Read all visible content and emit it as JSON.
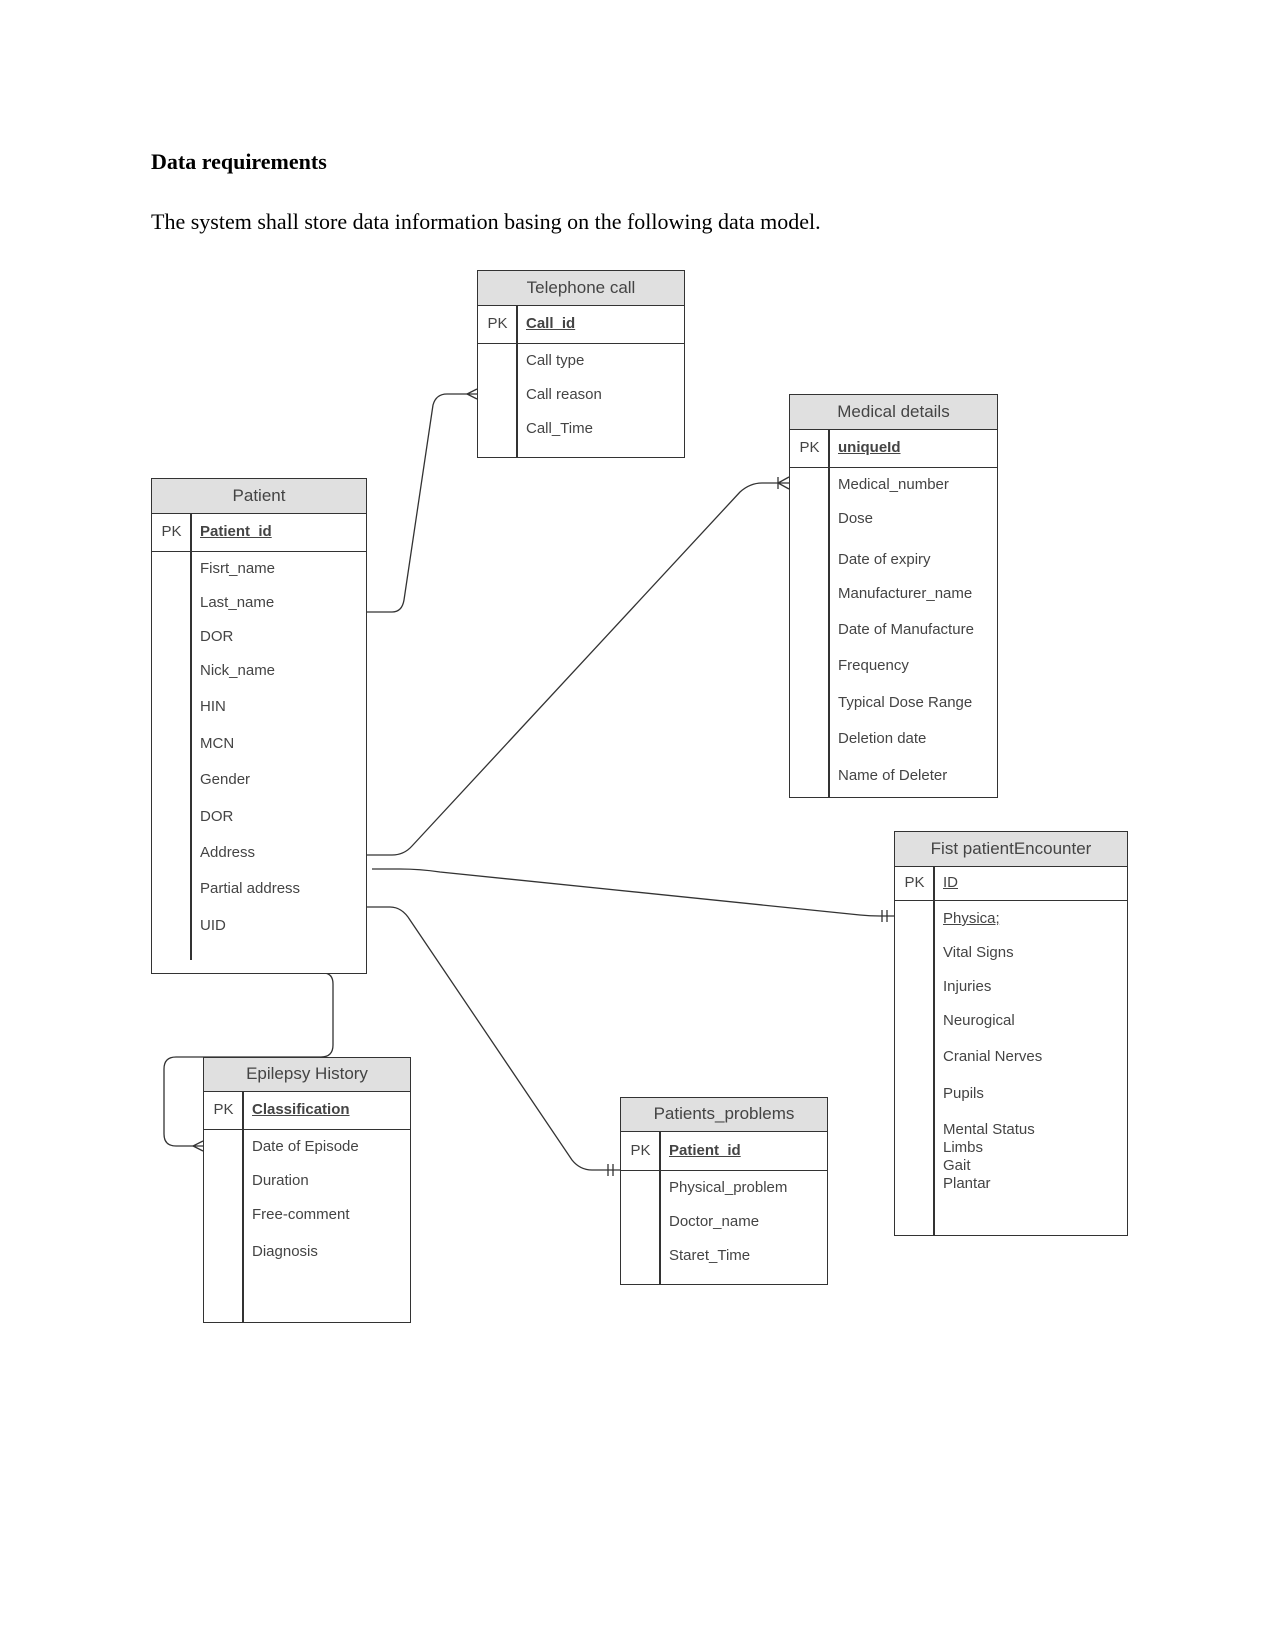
{
  "document": {
    "heading": "Data requirements",
    "paragraph": "The system shall store data information basing on the following data model."
  },
  "entities": {
    "telephone_call": {
      "title": "Telephone call",
      "pk_label": "PK",
      "pk": "Call_id",
      "attributes": [
        "Call type",
        "Call reason",
        "Call_Time"
      ]
    },
    "medical_details": {
      "title": "Medical details",
      "pk_label": "PK",
      "pk": "uniqueId",
      "attributes": [
        "Medical_number",
        "Dose",
        "Date of expiry",
        "Manufacturer_name",
        "Date of Manufacture",
        "Frequency",
        "Typical Dose Range",
        "Deletion date",
        "Name of Deleter"
      ]
    },
    "patient": {
      "title": "Patient",
      "pk_label": "PK",
      "pk": "Patient_id",
      "attributes": [
        "Fisrt_name",
        "Last_name",
        "DOR",
        "Nick_name",
        "HIN",
        "MCN",
        "Gender",
        "DOR",
        "Address",
        "Partial address",
        "UID"
      ]
    },
    "first_patient_encounter": {
      "title": "Fist patientEncounter",
      "pk_label": "PK",
      "pk": "ID",
      "attributes": [
        "Physica;",
        "Vital Signs",
        "Injuries",
        "Neurogical",
        "Cranial Nerves",
        "Pupils",
        "Mental Status",
        "Limbs",
        "Gait",
        "Plantar"
      ]
    },
    "epilepsy_history": {
      "title": "Epilepsy History",
      "pk_label": "PK",
      "pk": "Classification",
      "attributes": [
        "Date of Episode",
        "Duration",
        "Free-comment",
        "Diagnosis"
      ]
    },
    "patients_problems": {
      "title": "Patients_problems",
      "pk_label": "PK",
      "pk": "Patient_id",
      "attributes": [
        "Physical_problem",
        "Doctor_name",
        "Staret_Time"
      ]
    }
  },
  "relationships": [
    {
      "from": "Patient",
      "to": "Telephone call",
      "to_end": "crow-foot (many)"
    },
    {
      "from": "Patient",
      "to": "Medical details",
      "to_end": "one-or-many"
    },
    {
      "from": "Patient",
      "to": "Fist patientEncounter",
      "to_end": "one-and-only-one"
    },
    {
      "from": "Patient",
      "to": "Patients_problems",
      "to_end": "one-and-only-one"
    },
    {
      "from": "Patient",
      "to": "Epilepsy History",
      "to_end": "crow-foot (many)"
    }
  ],
  "colors": {
    "header_fill": "#e0e0e0",
    "border": "#333333",
    "text": "#444444",
    "line": "#333333"
  }
}
